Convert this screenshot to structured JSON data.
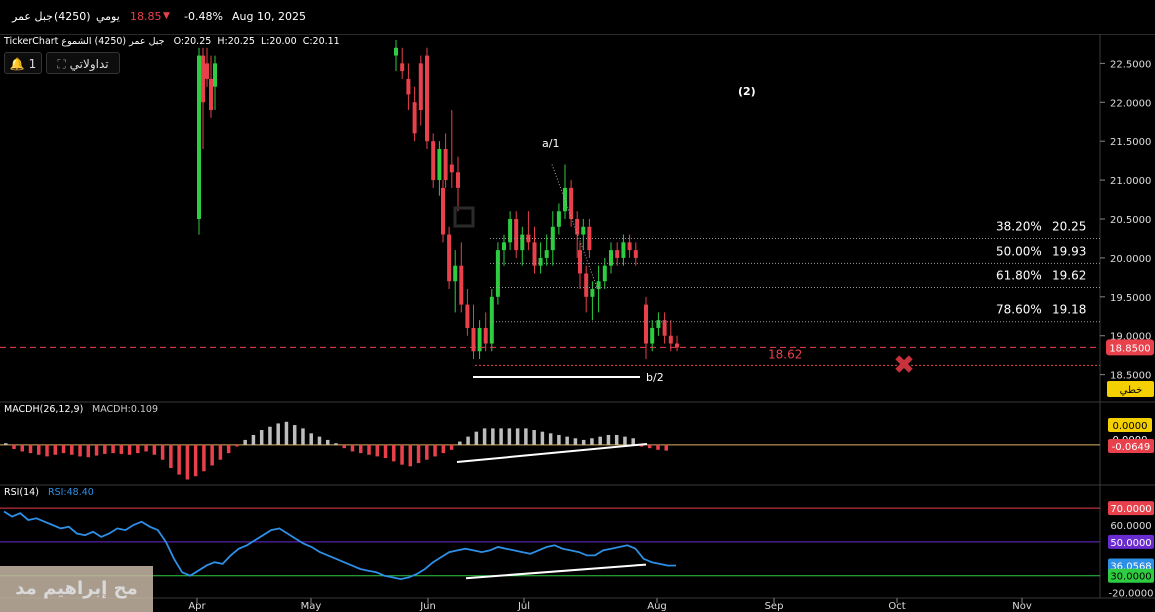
{
  "header": {
    "stock_name": "جبل عمر",
    "code": "(4250)",
    "period": "يومي",
    "price": "18.85",
    "change_pct": "-0.48%",
    "date": "Aug 10, 2025",
    "subtitle": "TickerChart جبل عمر (4250) الشموع",
    "ohlc": {
      "o": "O:20.25",
      "h": "H:20.25",
      "l": "L:20.00",
      "c": "C:20.11"
    },
    "alert_count": "1",
    "tadawulaty": "تداولاتي"
  },
  "colors": {
    "up": "#2ecc40",
    "down": "#e8414c",
    "bg": "#000000",
    "macd_pos": "#bdbdbd",
    "macd_neg": "#e8414c",
    "rsi": "#2e8fe6"
  },
  "watermark": "مح إبراهيم مد",
  "chart_data": [
    {
      "type": "candlestick",
      "title": "TickerChart جبل عمر (4250) الشموع",
      "x_ticks": [
        "Apr",
        "May",
        "Jun",
        "Jul",
        "Aug",
        "Sep",
        "Oct",
        "Nov"
      ],
      "y_ticks": [
        "22.5000",
        "22.0000",
        "21.5000",
        "21.0000",
        "20.5000",
        "20.0000",
        "19.5000",
        "19.0000",
        "18.5000"
      ],
      "ylim": [
        18.2,
        22.8
      ],
      "last_price_label": "18.8500",
      "mode_label": "خطي",
      "candles": [
        [
          20.5,
          22.7,
          20.3,
          22.6
        ],
        [
          22.6,
          22.7,
          21.4,
          22.0
        ],
        [
          22.5,
          22.7,
          22.2,
          22.3
        ],
        [
          22.3,
          22.6,
          21.8,
          21.9
        ],
        [
          22.2,
          22.6,
          21.9,
          22.5
        ],
        [
          22.6,
          22.8,
          22.4,
          22.7
        ],
        [
          22.5,
          22.7,
          22.3,
          22.4
        ],
        [
          22.3,
          22.5,
          21.9,
          22.1
        ],
        [
          22.0,
          22.2,
          21.5,
          21.6
        ],
        [
          22.5,
          22.6,
          21.7,
          21.9
        ],
        [
          22.6,
          22.7,
          21.4,
          21.5
        ],
        [
          21.5,
          21.6,
          20.9,
          21.0
        ],
        [
          21.0,
          21.5,
          20.8,
          21.4
        ],
        [
          21.4,
          21.6,
          20.9,
          21.0
        ],
        [
          21.2,
          21.9,
          20.9,
          21.1
        ],
        [
          21.1,
          21.3,
          20.6,
          20.9
        ],
        [
          20.9,
          21.0,
          20.2,
          20.3
        ],
        [
          20.3,
          20.4,
          19.6,
          19.7
        ],
        [
          19.7,
          20.1,
          19.3,
          19.9
        ],
        [
          19.9,
          20.2,
          19.3,
          19.4
        ],
        [
          19.4,
          19.6,
          19.0,
          19.1
        ],
        [
          19.1,
          19.4,
          18.7,
          18.8
        ],
        [
          18.8,
          19.2,
          18.7,
          19.1
        ],
        [
          19.1,
          19.3,
          18.8,
          18.9
        ],
        [
          18.9,
          19.6,
          18.8,
          19.5
        ],
        [
          19.5,
          20.2,
          19.4,
          20.1
        ],
        [
          20.1,
          20.3,
          19.9,
          20.2
        ],
        [
          20.2,
          20.6,
          20.1,
          20.5
        ],
        [
          20.5,
          20.6,
          20.0,
          20.1
        ],
        [
          20.1,
          20.4,
          19.9,
          20.3
        ],
        [
          20.3,
          20.6,
          20.1,
          20.2
        ],
        [
          20.2,
          20.4,
          19.8,
          19.9
        ],
        [
          19.9,
          20.2,
          19.8,
          20.0
        ],
        [
          20.0,
          20.3,
          19.9,
          20.1
        ],
        [
          20.1,
          20.6,
          19.9,
          20.4
        ],
        [
          20.4,
          20.7,
          20.3,
          20.6
        ],
        [
          20.6,
          21.2,
          20.5,
          20.9
        ],
        [
          20.9,
          21.0,
          20.4,
          20.5
        ],
        [
          20.5,
          20.6,
          20.0,
          20.3
        ],
        [
          20.3,
          20.5,
          20.1,
          20.4
        ],
        [
          20.4,
          20.5,
          20.0,
          20.1
        ],
        [
          20.1,
          20.2,
          19.6,
          19.8
        ],
        [
          19.8,
          19.9,
          19.3,
          19.5
        ],
        [
          19.5,
          19.7,
          19.2,
          19.6
        ],
        [
          19.6,
          19.9,
          19.3,
          19.7
        ],
        [
          19.7,
          20.0,
          19.6,
          19.9
        ],
        [
          19.9,
          20.2,
          19.8,
          20.1
        ],
        [
          20.1,
          20.2,
          19.9,
          20.0
        ],
        [
          20.0,
          20.3,
          19.9,
          20.2
        ],
        [
          20.2,
          20.3,
          20.0,
          20.1
        ],
        [
          20.1,
          20.2,
          19.9,
          20.0
        ],
        [
          19.4,
          19.5,
          18.7,
          18.9
        ],
        [
          18.9,
          19.2,
          18.8,
          19.1
        ],
        [
          19.1,
          19.3,
          19.0,
          19.2
        ],
        [
          19.2,
          19.3,
          18.9,
          19.0
        ],
        [
          19.0,
          19.2,
          18.8,
          18.9
        ],
        [
          18.9,
          19.0,
          18.8,
          18.85
        ]
      ],
      "fib_levels": [
        {
          "pct": "38.20%",
          "value": 20.25
        },
        {
          "pct": "50.00%",
          "value": 19.93
        },
        {
          "pct": "61.80%",
          "value": 19.62
        },
        {
          "pct": "78.60%",
          "value": 19.18
        }
      ],
      "support_level": 18.62,
      "current_price": 18.85,
      "annotations": [
        "a/1",
        "b/2",
        "(2)"
      ]
    },
    {
      "type": "histogram",
      "title": "MACDH(26,12,9)",
      "value_label": "MACDH:0.109",
      "y_labels": [
        "0.0000",
        "0.0000",
        "-0.0649"
      ],
      "values": [
        0.02,
        -0.05,
        -0.08,
        -0.1,
        -0.12,
        -0.14,
        -0.12,
        -0.1,
        -0.12,
        -0.14,
        -0.15,
        -0.13,
        -0.11,
        -0.1,
        -0.11,
        -0.12,
        -0.1,
        -0.08,
        -0.12,
        -0.18,
        -0.28,
        -0.36,
        -0.42,
        -0.38,
        -0.32,
        -0.25,
        -0.18,
        -0.1,
        -0.02,
        0.06,
        0.12,
        0.18,
        0.22,
        0.26,
        0.28,
        0.24,
        0.2,
        0.14,
        0.1,
        0.06,
        0.02,
        -0.04,
        -0.08,
        -0.1,
        -0.12,
        -0.14,
        -0.16,
        -0.2,
        -0.24,
        -0.26,
        -0.22,
        -0.18,
        -0.14,
        -0.1,
        -0.06,
        0.04,
        0.1,
        0.16,
        0.2,
        0.2,
        0.2,
        0.2,
        0.2,
        0.2,
        0.18,
        0.16,
        0.14,
        0.12,
        0.1,
        0.08,
        0.06,
        0.08,
        0.1,
        0.12,
        0.12,
        0.1,
        0.08,
        -0.02,
        -0.04,
        -0.06,
        -0.07
      ],
      "ylim": [
        -0.45,
        0.35
      ]
    },
    {
      "type": "line",
      "title": "RSI(14)",
      "value_label": "RSI:48.40",
      "y_labels": [
        "70.0000",
        "60.0000",
        "50.0000",
        "36.0568",
        "30.0000",
        "-20.0000"
      ],
      "ylim": [
        18,
        76
      ],
      "levels": [
        70,
        50,
        30
      ],
      "values": [
        68,
        65,
        67,
        63,
        64,
        62,
        60,
        58,
        59,
        55,
        54,
        56,
        53,
        55,
        58,
        57,
        60,
        62,
        59,
        57,
        50,
        40,
        32,
        30,
        33,
        36,
        38,
        37,
        42,
        46,
        48,
        51,
        54,
        57,
        58,
        55,
        52,
        49,
        47,
        44,
        42,
        40,
        38,
        36,
        34,
        33,
        32,
        30,
        29,
        28,
        29,
        31,
        34,
        38,
        41,
        44,
        45,
        46,
        45,
        44,
        45,
        47,
        46,
        45,
        44,
        43,
        45,
        47,
        48,
        46,
        45,
        44,
        42,
        42,
        45,
        46,
        47,
        48,
        46,
        40,
        38,
        37,
        36,
        36.06
      ]
    }
  ]
}
